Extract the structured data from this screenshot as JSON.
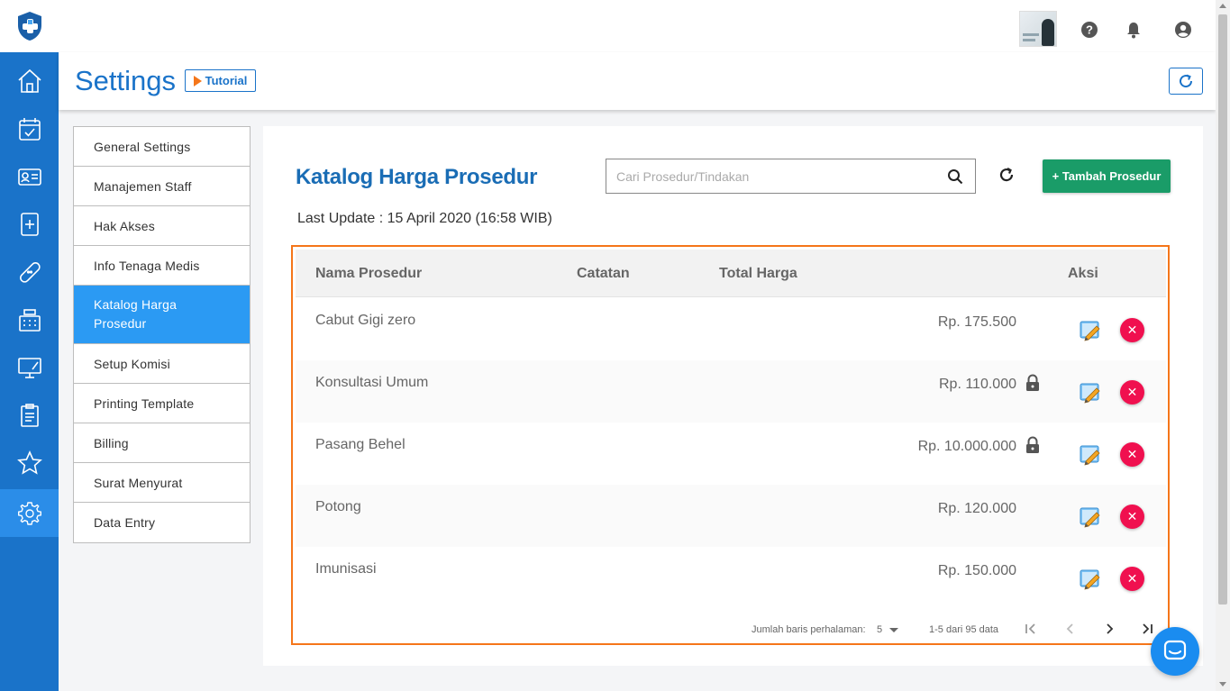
{
  "header": {
    "title": "Settings",
    "tutorial_label": "Tutorial"
  },
  "settings_menu": {
    "items": [
      {
        "label": "General Settings"
      },
      {
        "label": "Manajemen Staff"
      },
      {
        "label": "Hak Akses"
      },
      {
        "label": "Info Tenaga Medis"
      },
      {
        "label": "Katalog Harga Prosedur",
        "active": true
      },
      {
        "label": "Setup Komisi"
      },
      {
        "label": "Printing Template"
      },
      {
        "label": "Billing"
      },
      {
        "label": "Surat Menyurat"
      },
      {
        "label": "Data Entry"
      }
    ]
  },
  "main": {
    "title": "Katalog Harga Prosedur",
    "search_placeholder": "Cari Prosedur/Tindakan",
    "add_button_label": "+ Tambah Prosedur",
    "last_update": "Last Update : 15 April 2020 (16:58 WIB)"
  },
  "table": {
    "columns": {
      "name": "Nama Prosedur",
      "note": "Catatan",
      "total": "Total Harga",
      "action": "Aksi"
    },
    "rows": [
      {
        "name": "Cabut Gigi zero",
        "note": "",
        "price": "Rp. 175.500",
        "locked": false
      },
      {
        "name": "Konsultasi Umum",
        "note": "",
        "price": "Rp. 110.000",
        "locked": true
      },
      {
        "name": "Pasang Behel",
        "note": "",
        "price": "Rp. 10.000.000",
        "locked": true
      },
      {
        "name": "Potong",
        "note": "",
        "price": "Rp. 120.000",
        "locked": false
      },
      {
        "name": "Imunisasi",
        "note": "",
        "price": "Rp. 150.000",
        "locked": false
      }
    ],
    "pagination": {
      "rows_per_page_label": "Jumlah baris perhalaman:",
      "rows_per_page": "5",
      "range": "1-5 dari 95 data"
    }
  },
  "colors": {
    "primary": "#1a73c9",
    "accent_orange": "#f5761a",
    "add_green": "#1a9c68",
    "delete_red": "#f0104f",
    "active_menu": "#2b9af3"
  },
  "icons": {
    "sidebar": [
      "home-icon",
      "calendar-check-icon",
      "id-card-icon",
      "medical-file-icon",
      "bandage-icon",
      "cash-register-icon",
      "monitor-icon",
      "clipboard-icon",
      "star-icon",
      "gear-icon"
    ],
    "topbar": [
      "help-icon",
      "bell-icon",
      "account-icon"
    ]
  }
}
